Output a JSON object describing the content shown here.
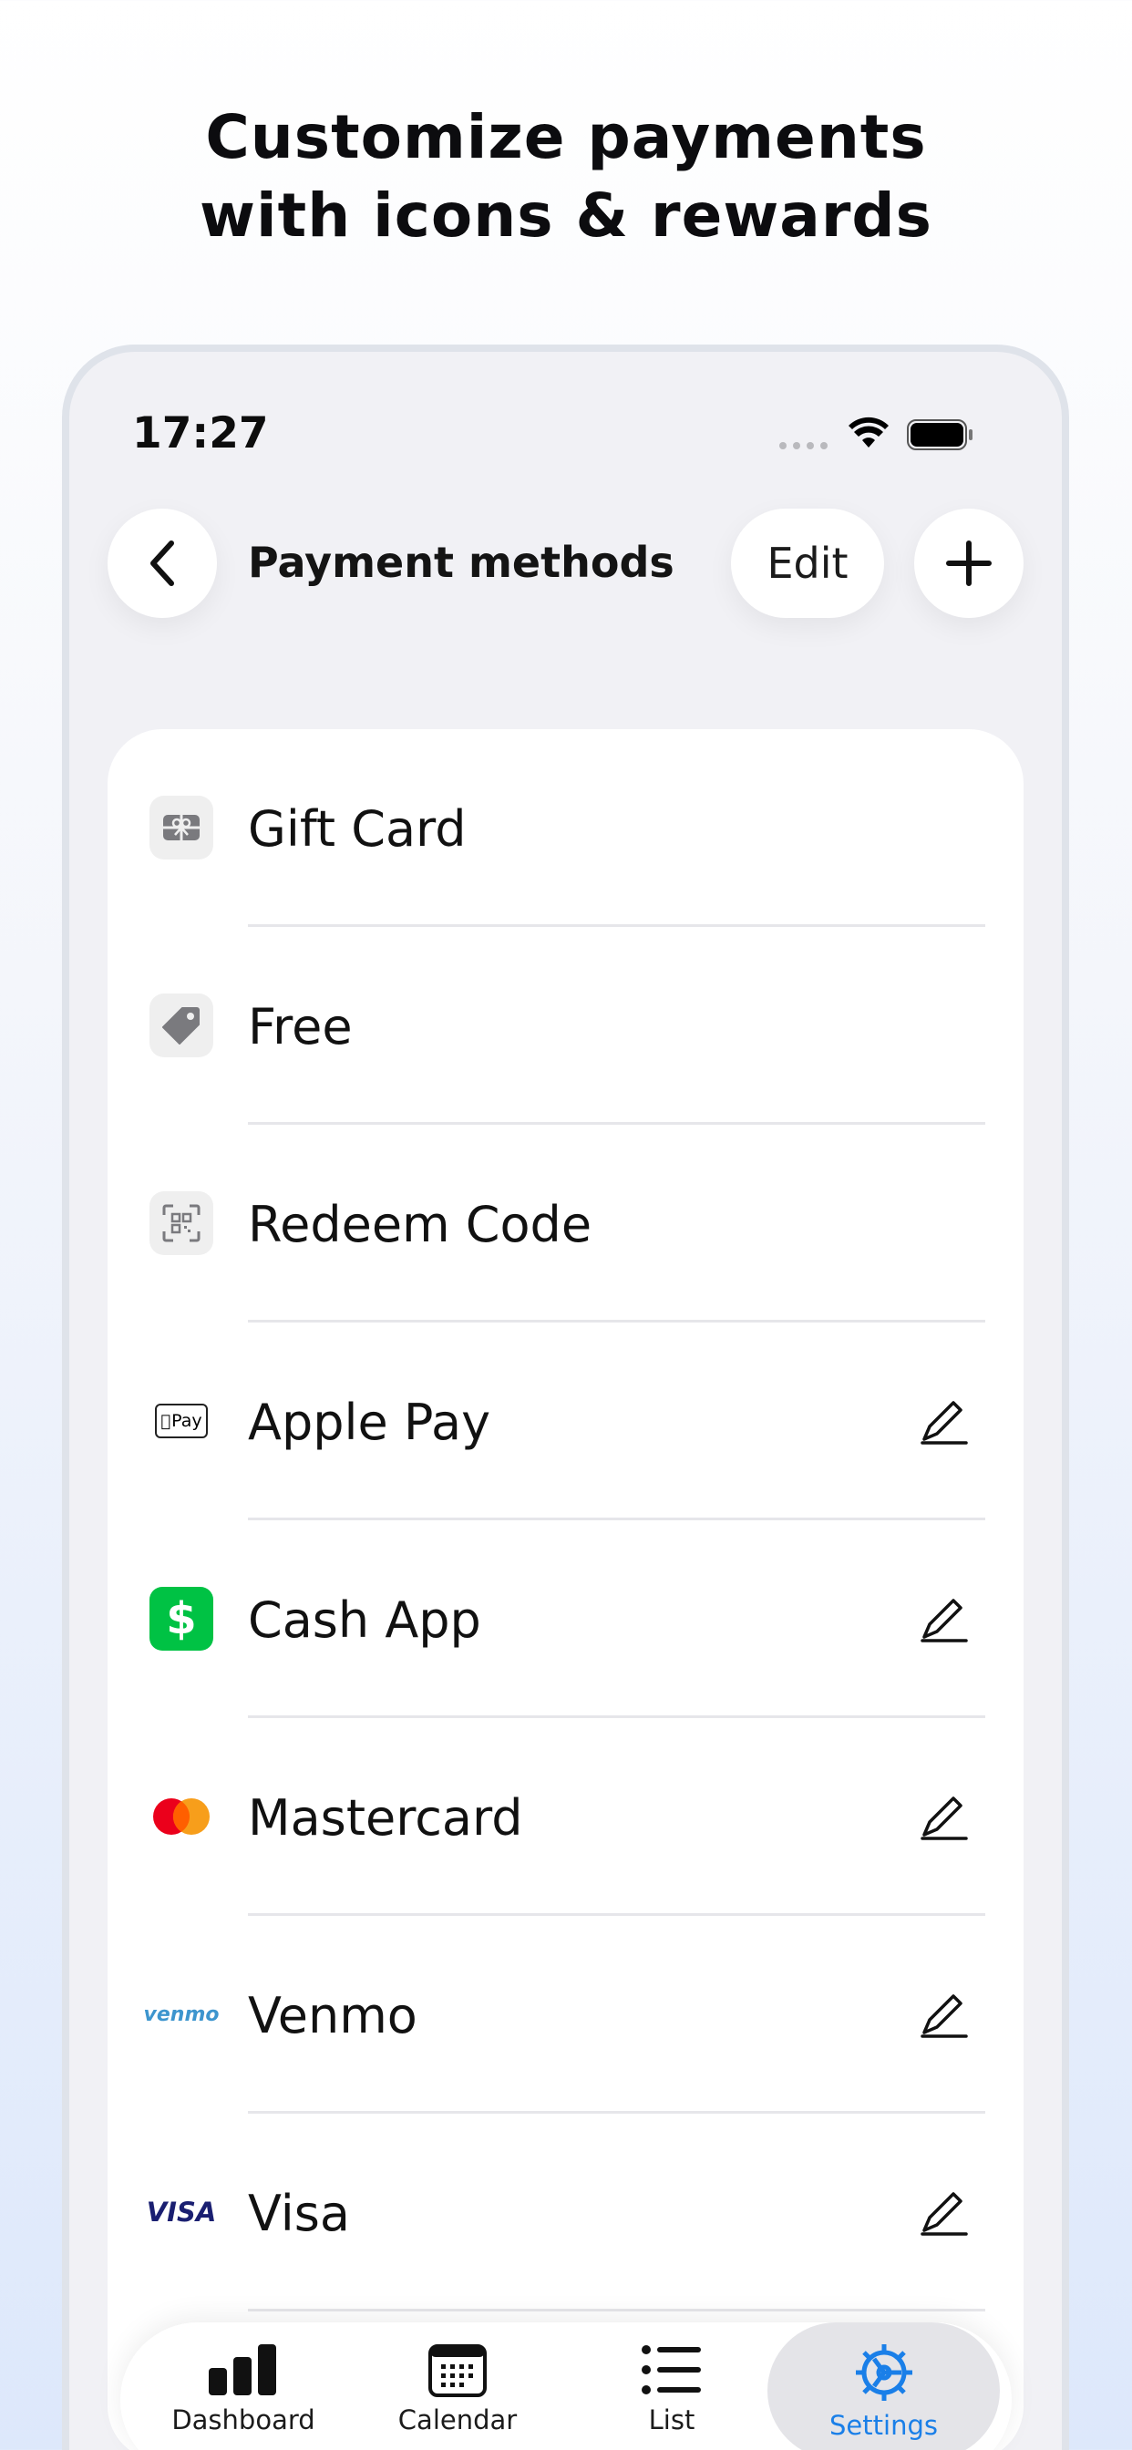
{
  "headline": {
    "line1": "Customize payments",
    "line2": "with icons & rewards"
  },
  "status_bar": {
    "time": "17:27"
  },
  "header": {
    "title": "Payment methods",
    "edit_label": "Edit"
  },
  "payment_methods": [
    {
      "label": "Gift Card",
      "icon": "gift-card-icon",
      "editable": false
    },
    {
      "label": "Free",
      "icon": "tag-icon",
      "editable": false
    },
    {
      "label": "Redeem Code",
      "icon": "qr-code-icon",
      "editable": false
    },
    {
      "label": "Apple Pay",
      "icon": "apple-pay-icon",
      "editable": true
    },
    {
      "label": "Cash App",
      "icon": "cash-app-icon",
      "editable": true
    },
    {
      "label": "Mastercard",
      "icon": "mastercard-icon",
      "editable": true
    },
    {
      "label": "Venmo",
      "icon": "venmo-icon",
      "editable": true
    },
    {
      "label": "Visa",
      "icon": "visa-icon",
      "editable": true
    }
  ],
  "brand_marks": {
    "apple_pay": "Pay",
    "venmo": "venmo",
    "visa": "VISA"
  },
  "tabbar": {
    "items": [
      {
        "label": "Dashboard",
        "icon": "bar-chart-icon",
        "active": false
      },
      {
        "label": "Calendar",
        "icon": "calendar-icon",
        "active": false
      },
      {
        "label": "List",
        "icon": "list-icon",
        "active": false
      },
      {
        "label": "Settings",
        "icon": "gear-icon",
        "active": true
      }
    ]
  },
  "colors": {
    "accent": "#1a7fe8",
    "cash_app": "#00c244",
    "mastercard_red": "#eb001b",
    "mastercard_orange": "#f79e1b",
    "venmo": "#3d95ce",
    "visa": "#1a1f71"
  }
}
